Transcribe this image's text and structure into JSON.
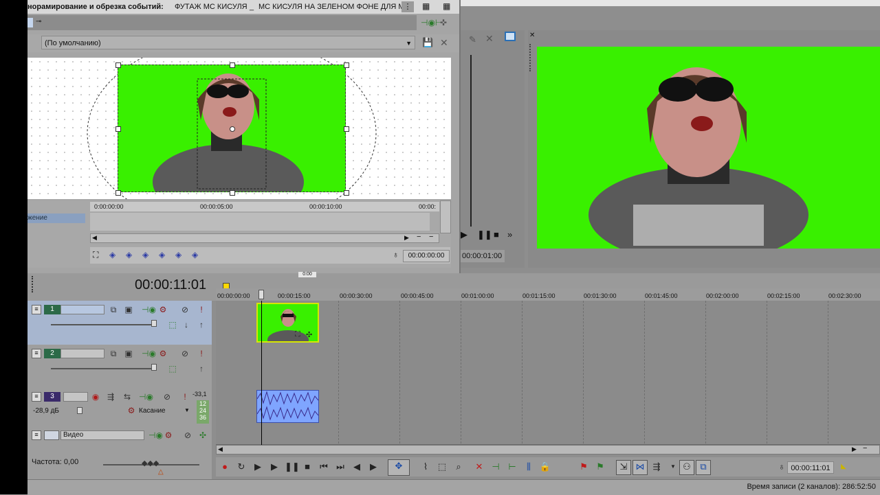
{
  "dialog": {
    "title_left": "норамирование и обрезка событий:",
    "title_file1": "ФУТАЖ МС КИСУЛЯ",
    "title_sep": "_",
    "title_file2": "МС КИСУЛЯ НА ЗЕЛЕНОМ ФОНЕ ДЛЯ М",
    "preset_value": "(По умолчанию)",
    "keyframe_row_label": "жение",
    "ruler_labels": [
      "0:00:00:00",
      "00:00:05:00",
      "00:00:10:00",
      "00:00:"
    ],
    "keyframe_timecode": "00:00:00:00"
  },
  "trimmer": {
    "timecode": "00:00:01:00"
  },
  "timeline": {
    "current_time": "00:00:11:01",
    "ruler_labels": [
      "00:00:00:00",
      "00:00:15:00",
      "00:00:30:00",
      "00:00:45:00",
      "00:01:00:00",
      "00:01:15:00",
      "00:01:30:00",
      "00:01:45:00",
      "00:02:00:00",
      "00:02:15:00",
      "00:02:30:00"
    ],
    "tracks": [
      {
        "number": "1",
        "type": "video",
        "selected": true
      },
      {
        "number": "2",
        "type": "video",
        "selected": false
      },
      {
        "number": "3",
        "type": "audio",
        "selected": false,
        "volume": "-28,9 дБ",
        "mode": "Касание",
        "meter_top": "-33,1",
        "meter_values": [
          "12",
          "24",
          "36"
        ]
      }
    ],
    "bus_label": "Видео",
    "frequency_label": "Частота: 0,00",
    "cursor_timecode": "00:00:11:01",
    "marker_label": "0:00"
  },
  "status": {
    "record_time": "Время записи (2 каналов): 286:52:50"
  },
  "colors": {
    "chroma_green": "#39f000",
    "selection_blue": "#a7b6cf",
    "audio_clip": "#7fa5ff"
  }
}
